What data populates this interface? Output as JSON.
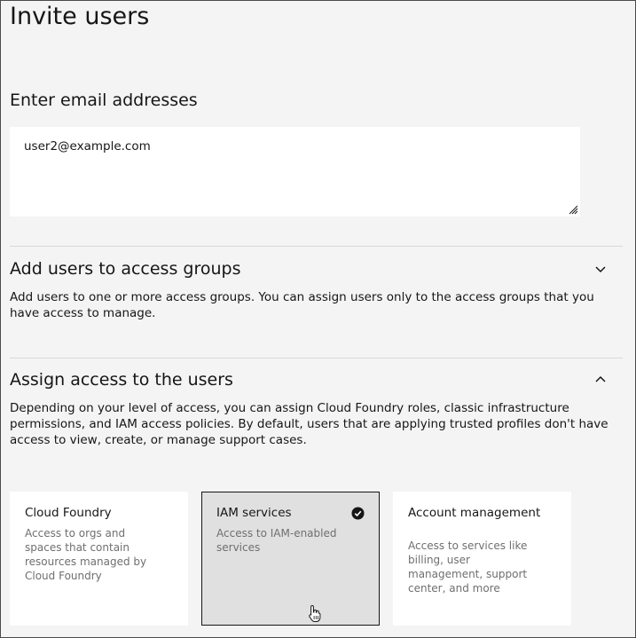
{
  "page": {
    "title": "Invite users"
  },
  "email": {
    "label": "Enter email addresses",
    "value": "user2@example.com"
  },
  "access_groups": {
    "title": "Add users to access groups",
    "description": "Add users to one or more access groups. You can assign users only to the access groups that you have access to manage.",
    "expanded": false,
    "chevron_icon": "chevron-down-icon"
  },
  "assign_access": {
    "title": "Assign access to the users",
    "description": "Depending on your level of access, you can assign Cloud Foundry roles, classic infrastructure permissions, and IAM access policies. By default, users that are applying trusted profiles don't have access to view, create, or manage support cases.",
    "expanded": true,
    "chevron_icon": "chevron-up-icon"
  },
  "tiles": [
    {
      "title": "Cloud Foundry",
      "description": "Access to orgs and spaces that contain resources managed by Cloud Foundry",
      "selected": false
    },
    {
      "title": "IAM services",
      "description": "Access to IAM-enabled services",
      "selected": true,
      "icon": "checkmark-filled-icon"
    },
    {
      "title": "Account management",
      "description": "Access to services like billing, user management, support center, and more",
      "selected": false
    }
  ],
  "colors": {
    "background": "#f4f4f4",
    "surface": "#ffffff",
    "selected_tile": "#e0e0e0",
    "text_primary": "#161616",
    "text_secondary": "#6f6f6f",
    "divider": "#d8d8d8"
  }
}
